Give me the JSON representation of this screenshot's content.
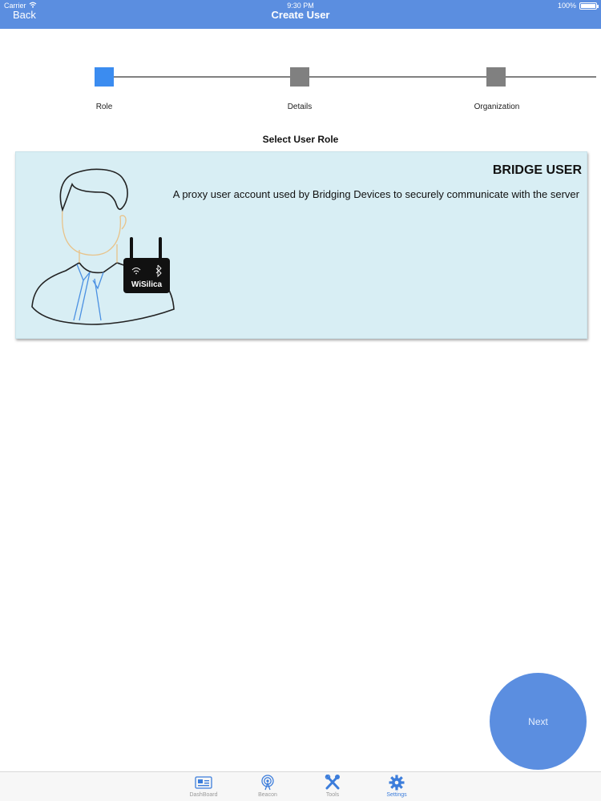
{
  "status_bar": {
    "carrier": "Carrier",
    "time": "9:30 PM",
    "battery": "100%"
  },
  "nav": {
    "back_label": "Back",
    "title": "Create User"
  },
  "stepper": {
    "steps": [
      {
        "label": "Role",
        "state": "active",
        "color": "#3b8cf0"
      },
      {
        "label": "Details",
        "state": "pending",
        "color": "#808080"
      },
      {
        "label": "Organization",
        "state": "pending",
        "color": "#808080"
      }
    ]
  },
  "section_title": "Select User Role",
  "role_card": {
    "title": "BRIDGE USER",
    "description": "A proxy user account used by Bridging Devices to securely communicate with the server",
    "device_brand": "WiSilica",
    "background": "#d8eef4"
  },
  "next_button": {
    "label": "Next"
  },
  "tabs": [
    {
      "label": "DashBoard",
      "icon": "dashboard-icon",
      "active": false
    },
    {
      "label": "Beacon",
      "icon": "beacon-icon",
      "active": false
    },
    {
      "label": "Tools",
      "icon": "tools-icon",
      "active": false
    },
    {
      "label": "Settings",
      "icon": "settings-gear-icon",
      "active": true
    }
  ],
  "colors": {
    "accent": "#5b8ee0",
    "active_tab": "#3c7ddb"
  }
}
